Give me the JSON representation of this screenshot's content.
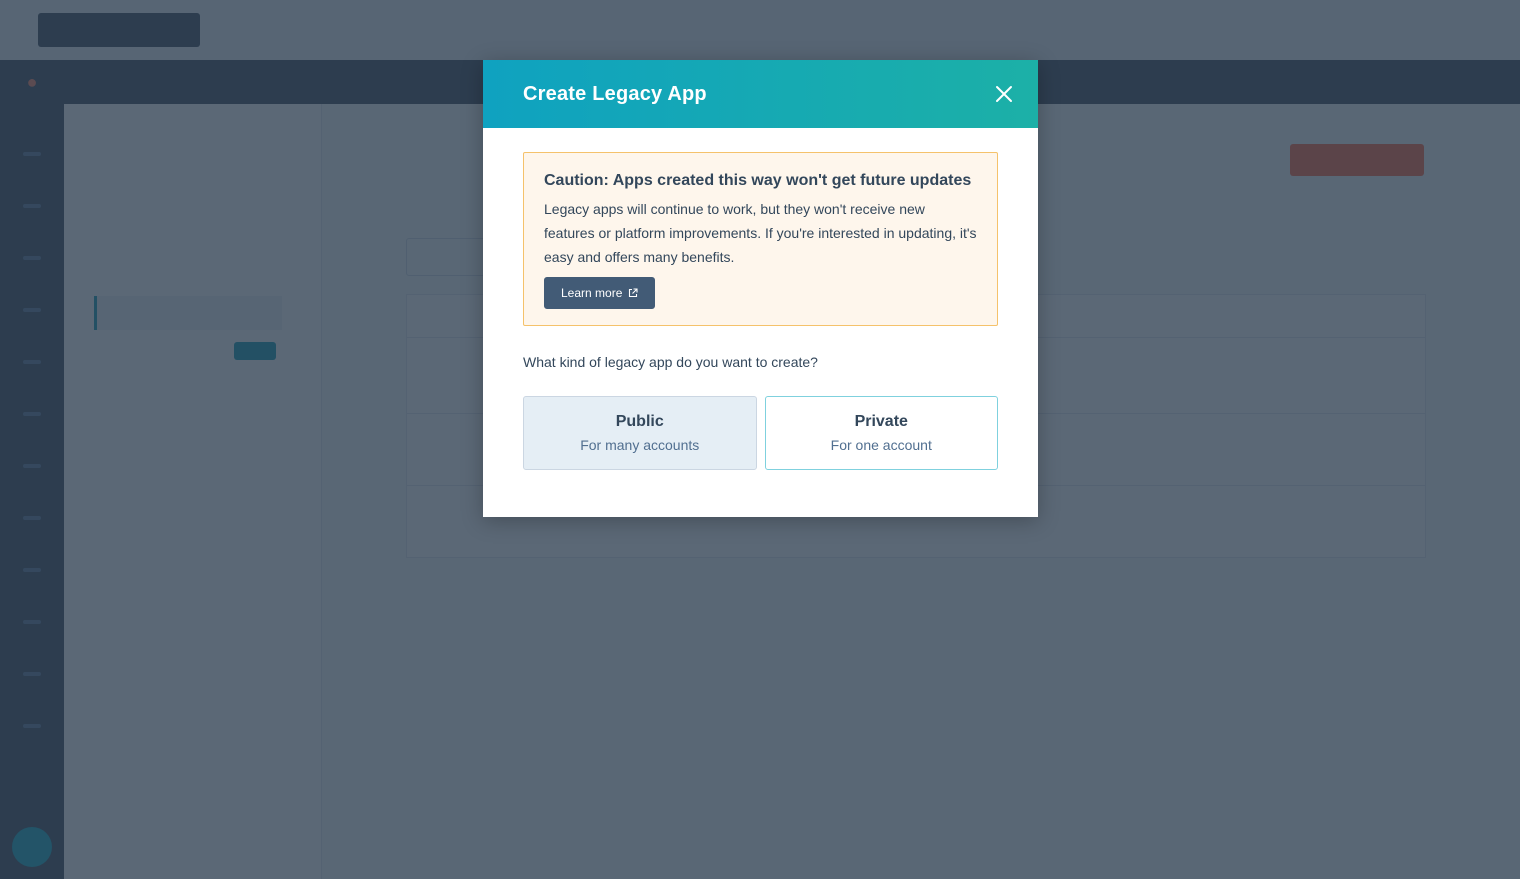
{
  "modal": {
    "title": "Create Legacy App",
    "caution": {
      "title": "Caution: Apps created this way won't get future updates",
      "text": "Legacy apps will continue to work, but they won't receive new features or platform improvements. If you're interested in updating, it's easy and offers many benefits.",
      "learn_more_label": "Learn more"
    },
    "question": "What kind of legacy app do you want to create?",
    "options": [
      {
        "title": "Public",
        "subtitle": "For many accounts",
        "selected": true
      },
      {
        "title": "Private",
        "subtitle": "For one account",
        "selected": false
      }
    ]
  },
  "colors": {
    "header_gradient_start": "#0fa2c0",
    "header_gradient_end": "#1cb0a7",
    "caution_bg": "#fef6ec",
    "caution_border": "#f5c26b",
    "button_dark": "#425b76",
    "overlay": "#2d3e50"
  },
  "icons": {
    "close": "close-icon",
    "external_link": "external-link-icon"
  }
}
